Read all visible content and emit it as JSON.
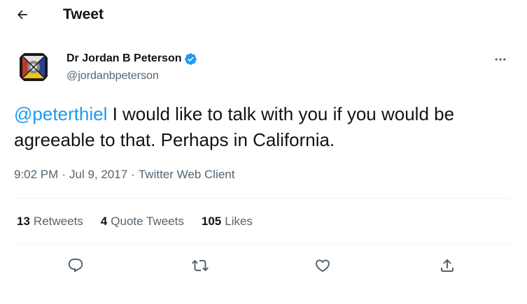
{
  "header": {
    "title": "Tweet"
  },
  "author": {
    "name": "Dr Jordan B Peterson",
    "handle": "@jordanbpeterson",
    "verified": true
  },
  "tweet": {
    "mention": "@peterthiel",
    "body": " I would like to talk with you if you would be agreeable to that. Perhaps in California."
  },
  "meta": {
    "time": "9:02 PM",
    "separator": "·",
    "date": "Jul 9, 2017",
    "client": "Twitter Web Client"
  },
  "stats": {
    "retweets_count": "13",
    "retweets_label": "Retweets",
    "quotes_count": "4",
    "quotes_label": "Quote Tweets",
    "likes_count": "105",
    "likes_label": "Likes"
  },
  "colors": {
    "accent": "#1d9bf0",
    "text": "#0f1419",
    "muted": "#536471",
    "divider": "#eff3f4"
  },
  "icons": {
    "back": "arrow-left-icon",
    "more": "more-horizontal-icon",
    "verified": "verified-badge-icon",
    "reply": "reply-icon",
    "retweet": "retweet-icon",
    "like": "heart-icon",
    "share": "share-icon"
  }
}
